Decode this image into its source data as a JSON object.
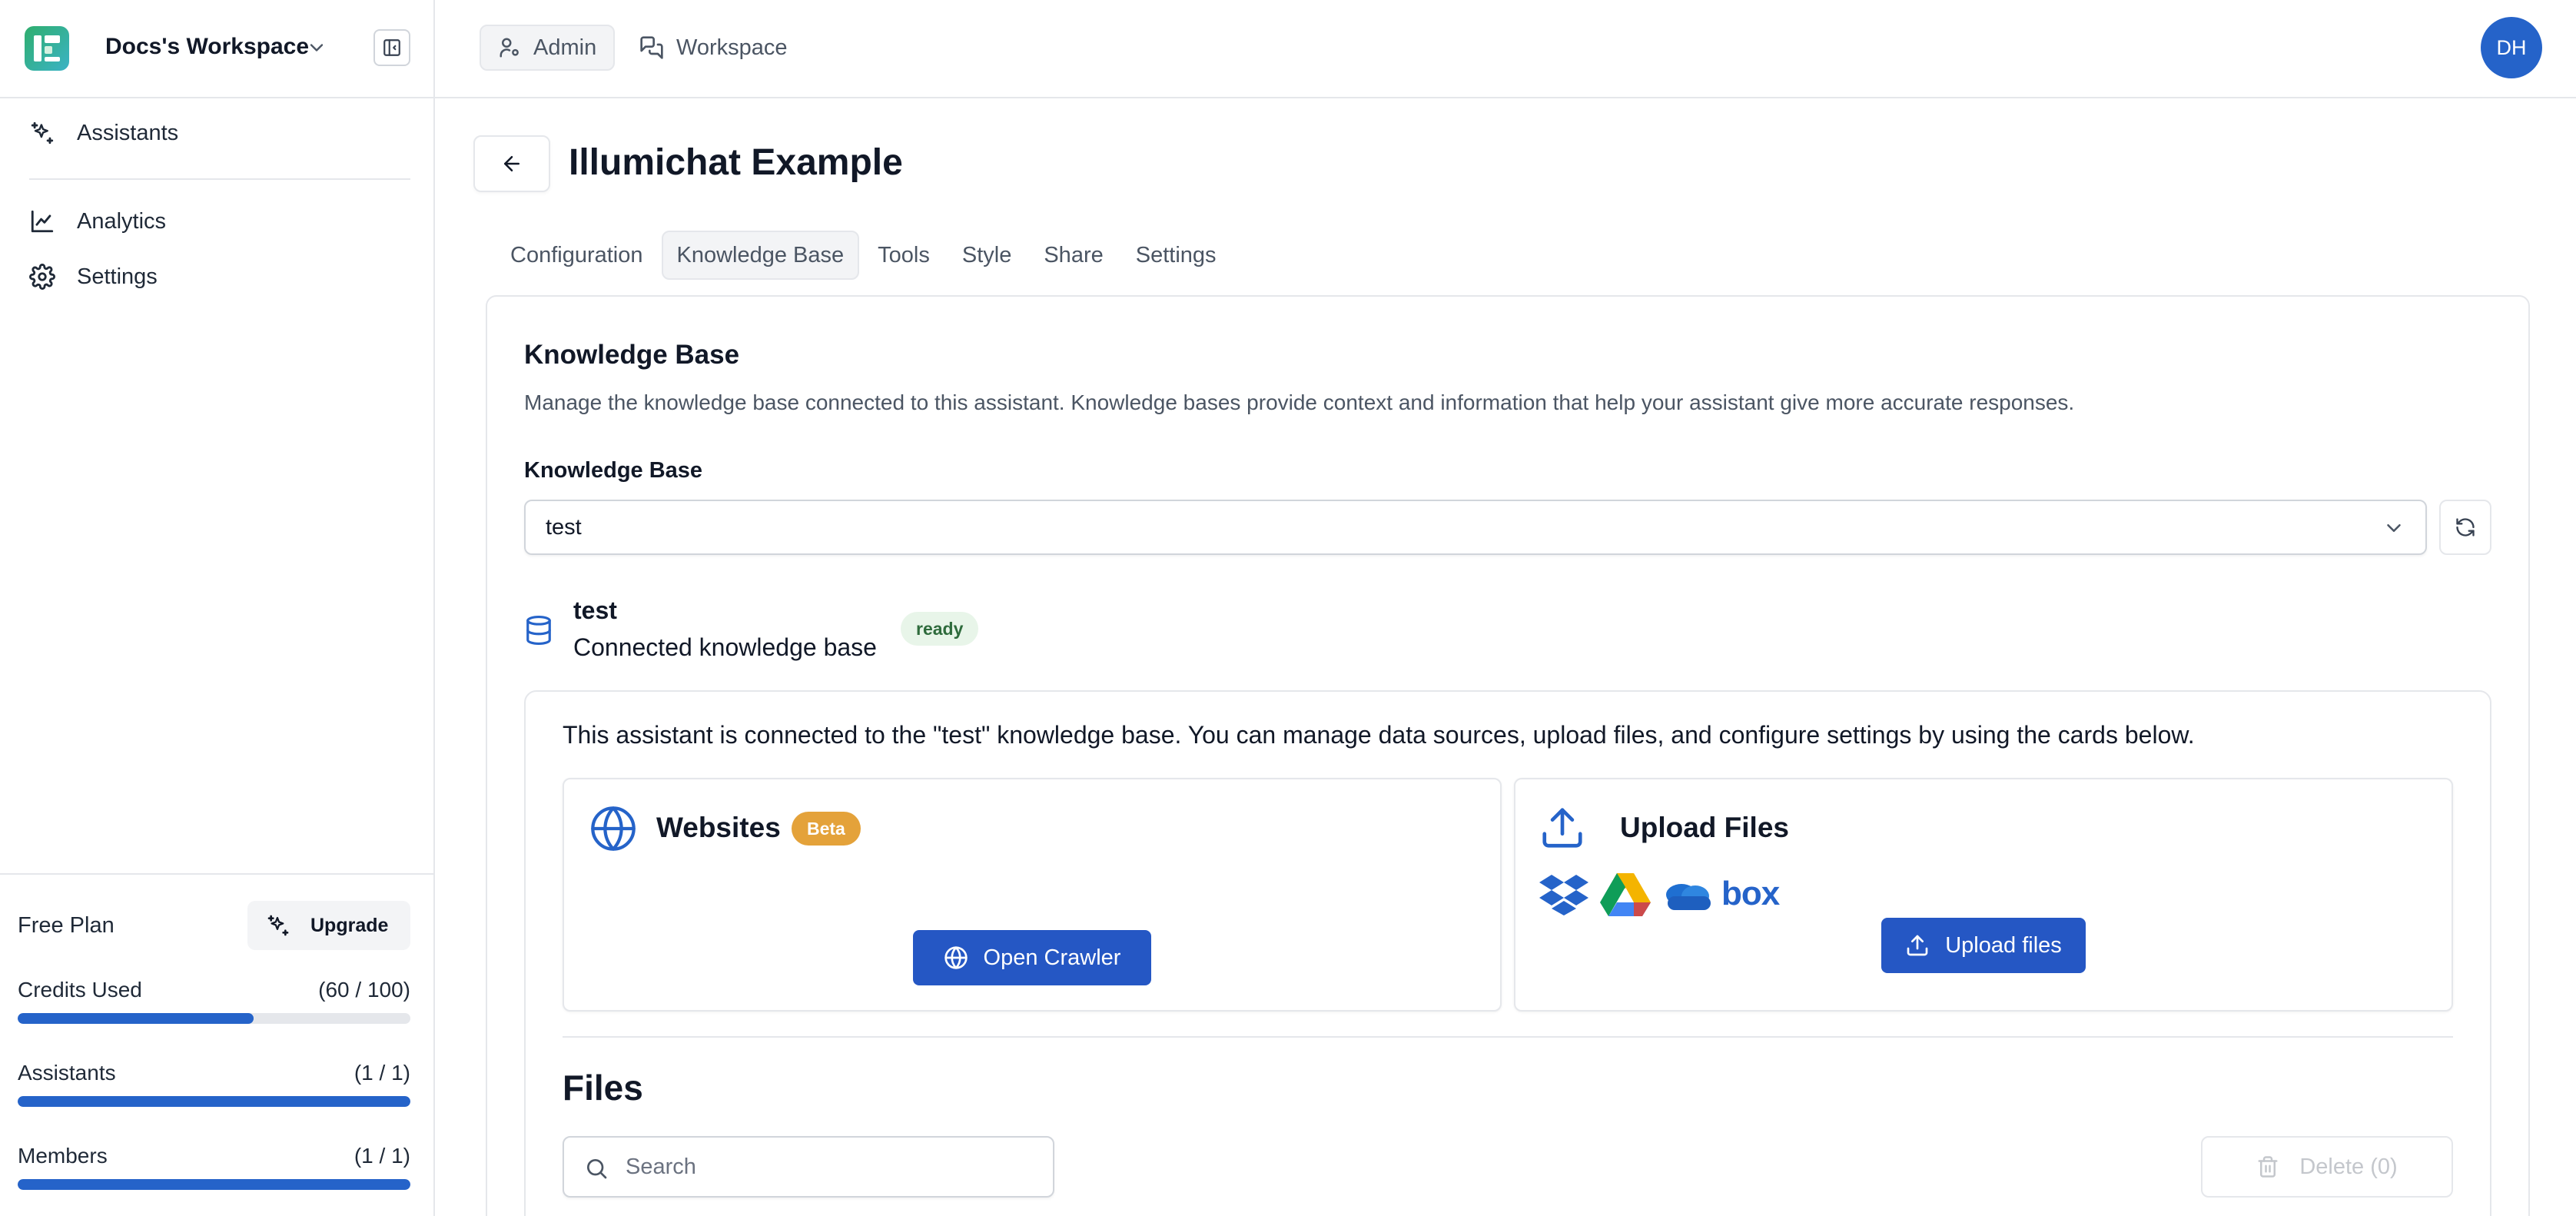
{
  "workspace": {
    "name": "Docs's Workspace"
  },
  "sidebar": {
    "items": [
      {
        "label": "Assistants",
        "icon": "sparkles-icon"
      },
      {
        "label": "Analytics",
        "icon": "line-chart-icon"
      },
      {
        "label": "Settings",
        "icon": "gear-icon"
      }
    ],
    "plan": {
      "name": "Free Plan",
      "upgrade_label": "Upgrade",
      "meters": [
        {
          "label": "Credits Used",
          "value": "(60 / 100)",
          "fraction": 0.6
        },
        {
          "label": "Assistants",
          "value": "(1 / 1)",
          "fraction": 1.0
        },
        {
          "label": "Members",
          "value": "(1 / 1)",
          "fraction": 1.0
        }
      ]
    }
  },
  "topbar": {
    "tabs": [
      {
        "label": "Admin",
        "icon": "user-cog-icon",
        "active": true
      },
      {
        "label": "Workspace",
        "icon": "chat-bubbles-icon",
        "active": false
      }
    ],
    "avatar_initials": "DH"
  },
  "page": {
    "title": "Illumichat Example",
    "tabs": [
      {
        "label": "Configuration"
      },
      {
        "label": "Knowledge Base",
        "active": true
      },
      {
        "label": "Tools"
      },
      {
        "label": "Style"
      },
      {
        "label": "Share"
      },
      {
        "label": "Settings"
      }
    ]
  },
  "knowledge_base": {
    "heading": "Knowledge Base",
    "description": "Manage the knowledge base connected to this assistant. Knowledge bases provide context and information that help your assistant give more accurate responses.",
    "select_label": "Knowledge Base",
    "selected_value": "test",
    "connected": {
      "name": "test",
      "subtitle": "Connected knowledge base",
      "status": "ready"
    },
    "info_message": "This assistant is connected to the \"test\" knowledge base. You can manage data sources, upload files, and configure settings by using the cards below.",
    "websites_card": {
      "title": "Websites",
      "badge": "Beta",
      "button_label": "Open Crawler"
    },
    "upload_card": {
      "title": "Upload Files",
      "providers": [
        "dropbox-icon",
        "google-drive-icon",
        "onedrive-icon",
        "box-icon"
      ],
      "box_text": "box",
      "button_label": "Upload files"
    }
  },
  "files": {
    "heading": "Files",
    "search_placeholder": "Search",
    "delete_label": "Delete (0)"
  },
  "colors": {
    "primary": "#2557c4",
    "progress": "#2563c9",
    "beta_badge": "#e4a23a",
    "ready_badge_bg": "#e8f5e9",
    "ready_badge_text": "#2e6b3c"
  }
}
